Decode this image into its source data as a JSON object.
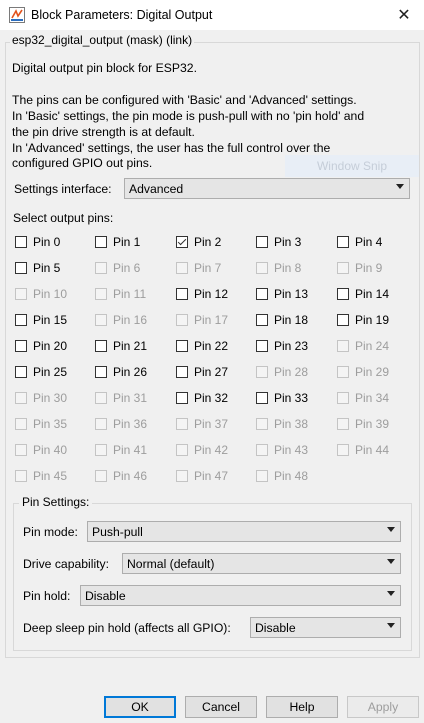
{
  "window": {
    "title": "Block Parameters: Digital Output"
  },
  "mask": {
    "title": "esp32_digital_output (mask) (link)",
    "description_lines": [
      "Digital output pin block for ESP32.",
      "",
      "The pins can be configured with 'Basic' and 'Advanced' settings.",
      "In 'Basic' settings, the pin mode is push-pull with no 'pin hold' and",
      "the pin drive strength is at default.",
      "In 'Advanced' settings, the user has the full control over the",
      "configured GPIO out pins."
    ]
  },
  "overlay_text": "Window Snip",
  "settings_interface": {
    "label": "Settings interface:",
    "value": "Advanced"
  },
  "select_pins_label": "Select output pins:",
  "pins": [
    {
      "label": "Pin 0",
      "enabled": true,
      "checked": false
    },
    {
      "label": "Pin 1",
      "enabled": true,
      "checked": false
    },
    {
      "label": "Pin 2",
      "enabled": true,
      "checked": true
    },
    {
      "label": "Pin 3",
      "enabled": true,
      "checked": false
    },
    {
      "label": "Pin 4",
      "enabled": true,
      "checked": false
    },
    {
      "label": "Pin 5",
      "enabled": true,
      "checked": false
    },
    {
      "label": "Pin 6",
      "enabled": false,
      "checked": false
    },
    {
      "label": "Pin 7",
      "enabled": false,
      "checked": false
    },
    {
      "label": "Pin 8",
      "enabled": false,
      "checked": false
    },
    {
      "label": "Pin 9",
      "enabled": false,
      "checked": false
    },
    {
      "label": "Pin 10",
      "enabled": false,
      "checked": false
    },
    {
      "label": "Pin 11",
      "enabled": false,
      "checked": false
    },
    {
      "label": "Pin 12",
      "enabled": true,
      "checked": false
    },
    {
      "label": "Pin 13",
      "enabled": true,
      "checked": false
    },
    {
      "label": "Pin 14",
      "enabled": true,
      "checked": false
    },
    {
      "label": "Pin 15",
      "enabled": true,
      "checked": false
    },
    {
      "label": "Pin 16",
      "enabled": false,
      "checked": false
    },
    {
      "label": "Pin 17",
      "enabled": false,
      "checked": false
    },
    {
      "label": "Pin 18",
      "enabled": true,
      "checked": false
    },
    {
      "label": "Pin 19",
      "enabled": true,
      "checked": false
    },
    {
      "label": "Pin 20",
      "enabled": true,
      "checked": false
    },
    {
      "label": "Pin 21",
      "enabled": true,
      "checked": false
    },
    {
      "label": "Pin 22",
      "enabled": true,
      "checked": false
    },
    {
      "label": "Pin 23",
      "enabled": true,
      "checked": false
    },
    {
      "label": "Pin 24",
      "enabled": false,
      "checked": false
    },
    {
      "label": "Pin 25",
      "enabled": true,
      "checked": false
    },
    {
      "label": "Pin 26",
      "enabled": true,
      "checked": false
    },
    {
      "label": "Pin 27",
      "enabled": true,
      "checked": false
    },
    {
      "label": "Pin 28",
      "enabled": false,
      "checked": false
    },
    {
      "label": "Pin 29",
      "enabled": false,
      "checked": false
    },
    {
      "label": "Pin 30",
      "enabled": false,
      "checked": false
    },
    {
      "label": "Pin 31",
      "enabled": false,
      "checked": false
    },
    {
      "label": "Pin 32",
      "enabled": true,
      "checked": false
    },
    {
      "label": "Pin 33",
      "enabled": true,
      "checked": false
    },
    {
      "label": "Pin 34",
      "enabled": false,
      "checked": false
    },
    {
      "label": "Pin 35",
      "enabled": false,
      "checked": false
    },
    {
      "label": "Pin 36",
      "enabled": false,
      "checked": false
    },
    {
      "label": "Pin 37",
      "enabled": false,
      "checked": false
    },
    {
      "label": "Pin 38",
      "enabled": false,
      "checked": false
    },
    {
      "label": "Pin 39",
      "enabled": false,
      "checked": false
    },
    {
      "label": "Pin 40",
      "enabled": false,
      "checked": false
    },
    {
      "label": "Pin 41",
      "enabled": false,
      "checked": false
    },
    {
      "label": "Pin 42",
      "enabled": false,
      "checked": false
    },
    {
      "label": "Pin 43",
      "enabled": false,
      "checked": false
    },
    {
      "label": "Pin 44",
      "enabled": false,
      "checked": false
    },
    {
      "label": "Pin 45",
      "enabled": false,
      "checked": false
    },
    {
      "label": "Pin 46",
      "enabled": false,
      "checked": false
    },
    {
      "label": "Pin 47",
      "enabled": false,
      "checked": false
    },
    {
      "label": "Pin 48",
      "enabled": false,
      "checked": false
    }
  ],
  "pin_settings": {
    "title": "Pin Settings:",
    "pin_mode": {
      "label": "Pin mode:",
      "value": "Push-pull"
    },
    "drive_capability": {
      "label": "Drive capability:",
      "value": "Normal (default)"
    },
    "pin_hold": {
      "label": "Pin hold:",
      "value": "Disable"
    },
    "deep_sleep": {
      "label": "Deep sleep pin hold (affects all GPIO):",
      "value": "Disable"
    }
  },
  "buttons": {
    "ok": "OK",
    "cancel": "Cancel",
    "help": "Help",
    "apply": "Apply"
  }
}
